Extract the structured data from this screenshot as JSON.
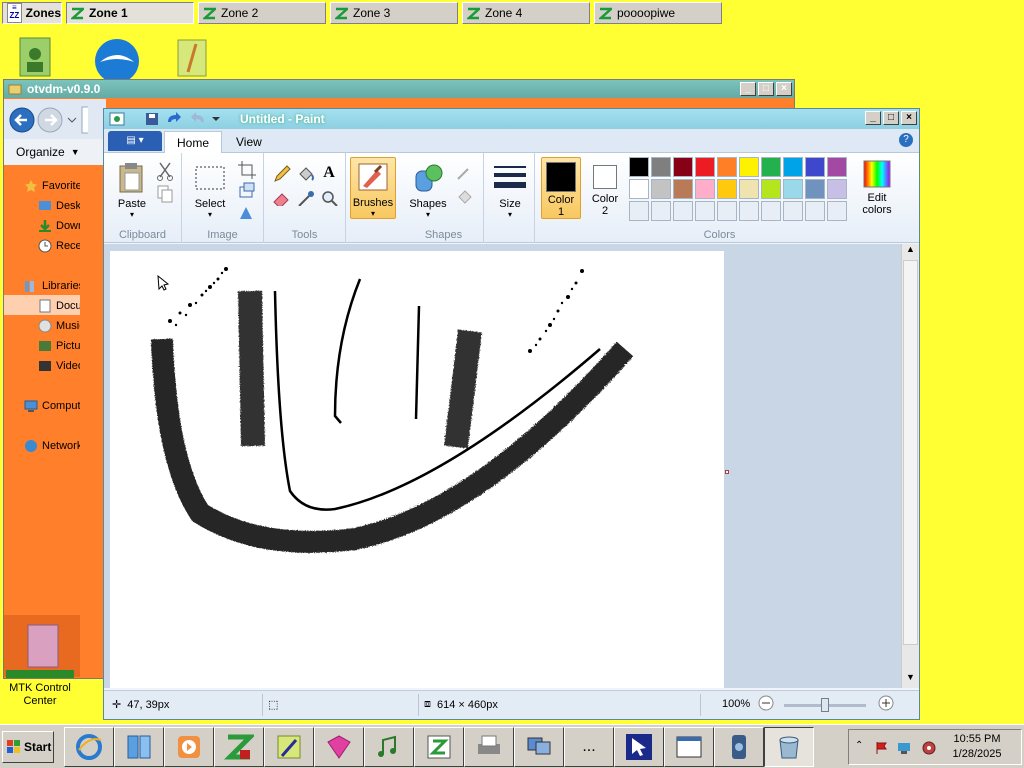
{
  "zonebar": {
    "app_label": "Zones",
    "zones": [
      "Zone 1",
      "Zone 2",
      "Zone 3",
      "Zone 4",
      "poooopiwe"
    ],
    "active_zone": "Zone 1"
  },
  "otvdm": {
    "title": "otvdm-v0.9.0",
    "organize": "Organize",
    "sidebar": [
      "Favorites",
      "Desktop",
      "Downloads",
      "Recent Places",
      "Libraries",
      "Documents",
      "Music",
      "Pictures",
      "Videos",
      "Computer",
      "Network"
    ]
  },
  "desktop": {
    "mtk_label": "MTK Control Center"
  },
  "paint": {
    "title": "Untitled - Paint",
    "tabs": [
      "Home",
      "View"
    ],
    "active_tab": "Home",
    "groups": {
      "clipboard": {
        "label": "Clipboard",
        "paste": "Paste"
      },
      "image": {
        "label": "Image",
        "select": "Select"
      },
      "tools": {
        "label": "Tools"
      },
      "brushes": {
        "label": "Brushes"
      },
      "shapes": {
        "label": "Shapes",
        "shapes_btn": "Shapes"
      },
      "size": {
        "label": "Size"
      },
      "colors": {
        "label": "Colors",
        "color1": "Color",
        "color1_num": "1",
        "color2": "Color",
        "color2_num": "2",
        "edit_colors_1": "Edit",
        "edit_colors_2": "colors"
      }
    },
    "color1_value": "#000000",
    "color2_value": "#ffffff",
    "palette_row1": [
      "#000000",
      "#7f7f7f",
      "#880015",
      "#ed1c24",
      "#ff7f27",
      "#fff200",
      "#22b14c",
      "#00a2e8",
      "#3f48cc",
      "#a349a4"
    ],
    "palette_row2": [
      "#ffffff",
      "#c3c3c3",
      "#b97a57",
      "#ffaec9",
      "#ffc90e",
      "#efe4b0",
      "#b5e61d",
      "#99d9ea",
      "#7092be",
      "#c8bfe7"
    ],
    "status": {
      "cursor_pos": "47, 39px",
      "image_size": "614 × 460px",
      "zoom": "100%",
      "zoom_level": 0.5
    }
  },
  "taskbar": {
    "start": "Start",
    "time": "10:55 PM",
    "date": "1/28/2025",
    "more": "..."
  }
}
